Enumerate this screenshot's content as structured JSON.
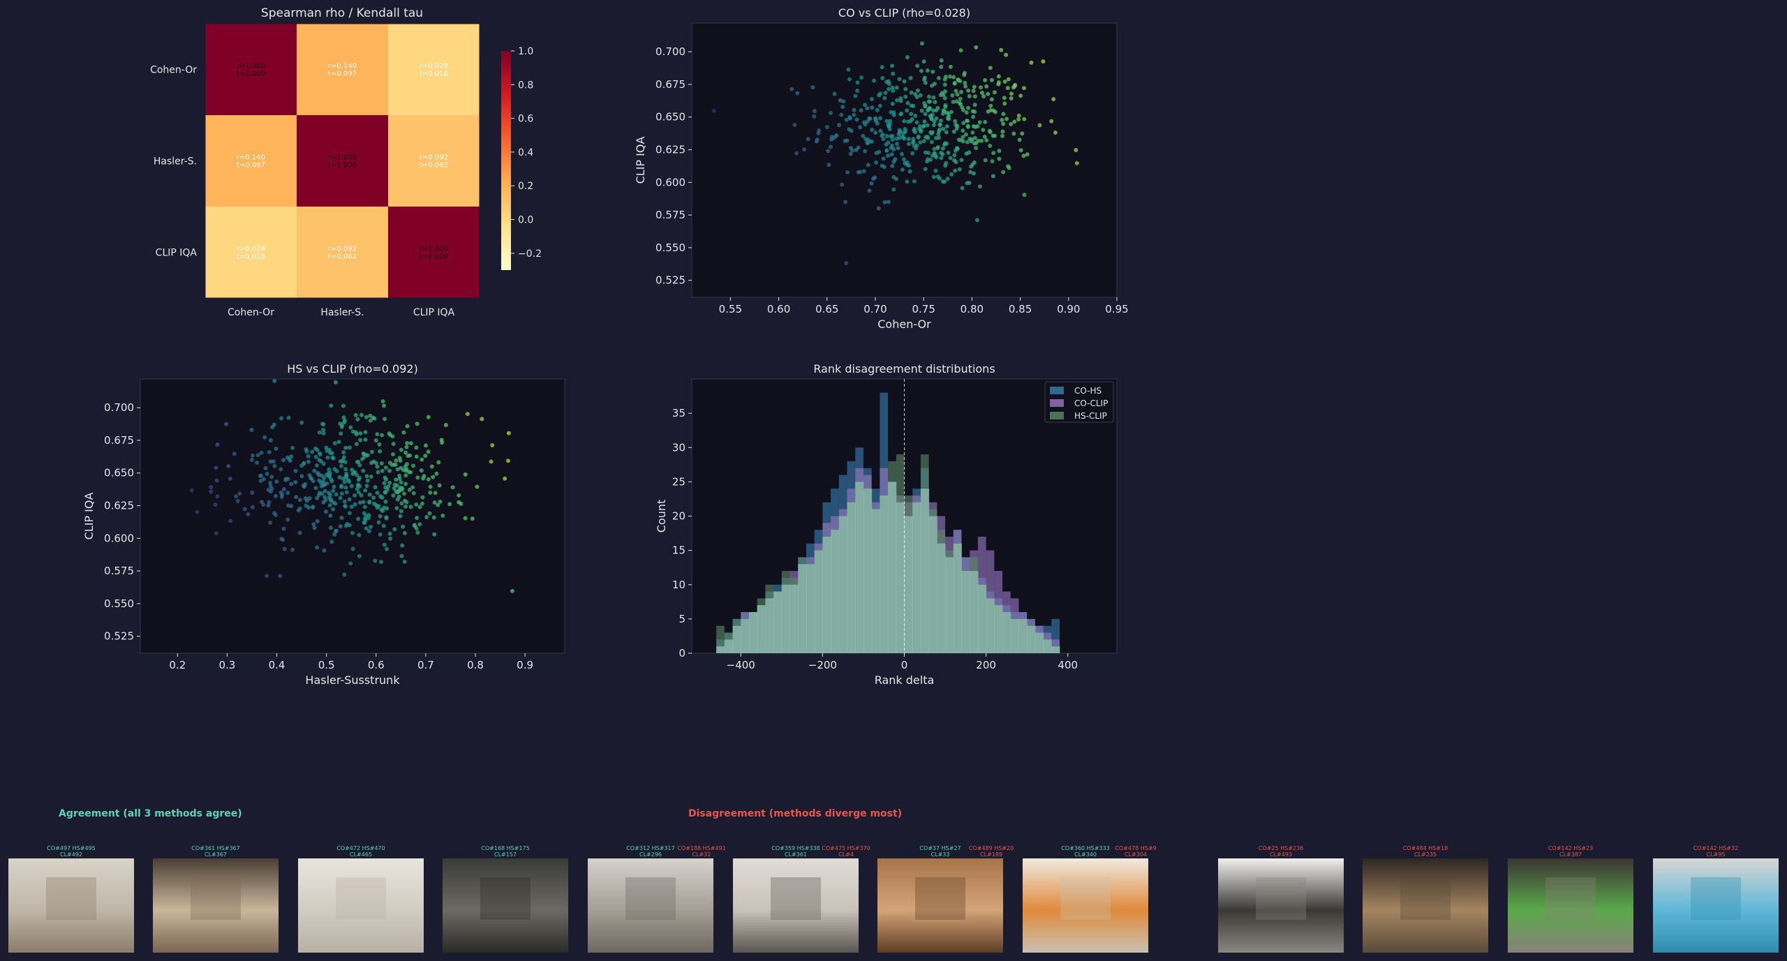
{
  "colors": {
    "background": "#1a1b2e",
    "axes_bg": "#0f101c",
    "agreement": "#5fd3b4",
    "disagreement": "#e8564c",
    "co_hs": "#3b80b2",
    "co_clip": "#9b79c6",
    "hs_clip": "#5b8a64"
  },
  "heatmap": {
    "title": "Spearman rho / Kendall tau",
    "row_labels": [
      "Cohen-Or",
      "Hasler-S.",
      "CLIP IQA"
    ],
    "col_labels": [
      "Cohen-Or",
      "Hasler-S.",
      "CLIP IQA"
    ],
    "colorbar_ticks": [
      "1.0",
      "0.8",
      "0.6",
      "0.4",
      "0.2",
      "0.0",
      "−0.2"
    ],
    "cells": [
      [
        {
          "r": "r=1.000",
          "t": "t=1.000",
          "v": 1.0
        },
        {
          "r": "r=0.140",
          "t": "t=0.097",
          "v": 0.14
        },
        {
          "r": "r=0.028",
          "t": "t=0.018",
          "v": 0.028
        }
      ],
      [
        {
          "r": "r=0.140",
          "t": "t=0.097",
          "v": 0.14
        },
        {
          "r": "r=1.000",
          "t": "t=1.000",
          "v": 1.0
        },
        {
          "r": "r=0.092",
          "t": "t=0.062",
          "v": 0.092
        }
      ],
      [
        {
          "r": "r=0.028",
          "t": "t=0.018",
          "v": 0.028
        },
        {
          "r": "r=0.092",
          "t": "t=0.062",
          "v": 0.092
        },
        {
          "r": "r=1.000",
          "t": "t=1.000",
          "v": 1.0
        }
      ]
    ]
  },
  "chart_data": [
    {
      "type": "scatter",
      "title": "CO vs CLIP (rho=0.028)",
      "xlabel": "Cohen-Or",
      "ylabel": "CLIP IQA",
      "xlim": [
        0.51,
        0.95
      ],
      "ylim": [
        0.512,
        0.722
      ],
      "xticks": [
        "0.55",
        "0.60",
        "0.65",
        "0.70",
        "0.75",
        "0.80",
        "0.85",
        "0.90",
        "0.95"
      ],
      "yticks": [
        "0.525",
        "0.550",
        "0.575",
        "0.600",
        "0.625",
        "0.650",
        "0.675",
        "0.700"
      ]
    },
    {
      "type": "scatter",
      "title": "HS vs CLIP (rho=0.092)",
      "xlabel": "Hasler-Susstrunk",
      "ylabel": "CLIP IQA",
      "xlim": [
        0.125,
        0.98
      ],
      "ylim": [
        0.512,
        0.722
      ],
      "xticks": [
        "0.2",
        "0.3",
        "0.4",
        "0.5",
        "0.6",
        "0.7",
        "0.8",
        "0.9"
      ],
      "yticks": [
        "0.525",
        "0.550",
        "0.575",
        "0.600",
        "0.625",
        "0.650",
        "0.675",
        "0.700"
      ]
    },
    {
      "type": "bar",
      "title": "Rank disagreement distributions",
      "xlabel": "Rank delta",
      "ylabel": "Count",
      "xlim": [
        -520,
        520
      ],
      "ylim": [
        0,
        40
      ],
      "xticks": [
        "−400",
        "−200",
        "0",
        "200",
        "400"
      ],
      "yticks": [
        "0",
        "5",
        "10",
        "15",
        "20",
        "25",
        "30",
        "35"
      ],
      "bin_start": -460,
      "bin_width": 20,
      "series": [
        {
          "name": "CO-HS",
          "values": [
            2,
            3,
            5,
            6,
            6,
            7,
            9,
            10,
            11,
            10,
            14,
            16,
            18,
            22,
            24,
            26,
            28,
            30,
            27,
            24,
            38,
            25,
            22,
            20,
            24,
            27,
            20,
            16,
            14,
            18,
            14,
            12,
            11,
            9,
            8,
            7,
            6,
            6,
            5,
            4,
            4,
            5
          ]
        },
        {
          "name": "CO-CLIP",
          "values": [
            1,
            2,
            4,
            6,
            6,
            7,
            8,
            9,
            10,
            12,
            13,
            14,
            16,
            19,
            20,
            21,
            24,
            27,
            26,
            22,
            27,
            25,
            23,
            22,
            23,
            24,
            22,
            20,
            17,
            18,
            14,
            15,
            17,
            15,
            12,
            9,
            8,
            6,
            5,
            4,
            3,
            2
          ]
        },
        {
          "name": "HS-CLIP",
          "values": [
            4,
            3,
            5,
            5,
            6,
            8,
            10,
            9,
            12,
            11,
            14,
            13,
            15,
            17,
            18,
            20,
            22,
            25,
            24,
            21,
            23,
            28,
            29,
            23,
            22,
            29,
            21,
            18,
            15,
            16,
            12,
            14,
            10,
            8,
            7,
            6,
            5,
            5,
            4,
            3,
            2,
            1
          ]
        }
      ]
    }
  ],
  "gallery": {
    "agreement_title": "Agreement (all 3 methods agree)",
    "disagreement_title": "Disagreement (methods diverge most)",
    "agree_items": [
      {
        "l1": "CO#497 HS#495",
        "l2": "CL#492"
      },
      {
        "l1": "CO#361 HS#367",
        "l2": "CL#367"
      },
      {
        "l1": "CO#472 HS#470",
        "l2": "CL#465"
      },
      {
        "l1": "CO#168 HS#175",
        "l2": "CL#157"
      },
      {
        "l1": "CO#312 HS#317",
        "l2": "CL#296"
      },
      {
        "l1": "CO#359 HS#338",
        "l2": "CL#361"
      },
      {
        "l1": "CO#37 HS#27",
        "l2": "CL#33"
      },
      {
        "l1": "CO#360 HS#333",
        "l2": "CL#340"
      }
    ],
    "disagree_items": [
      {
        "l1": "CO#188 HS#491",
        "l2": "CL#32"
      },
      {
        "l1": "CO#475 HS#370",
        "l2": "CL#4"
      },
      {
        "l1": "CO#489 HS#20",
        "l2": "CL#189"
      },
      {
        "l1": "CO#478 HS#9",
        "l2": "CL#304"
      },
      {
        "l1": "CO#25 HS#236",
        "l2": "CL#493"
      },
      {
        "l1": "CO#484 HS#18",
        "l2": "CL#235"
      },
      {
        "l1": "CO#142 HS#23",
        "l2": "CL#387"
      },
      {
        "l1": "CO#142 HS#32",
        "l2": "CL#95"
      }
    ]
  }
}
